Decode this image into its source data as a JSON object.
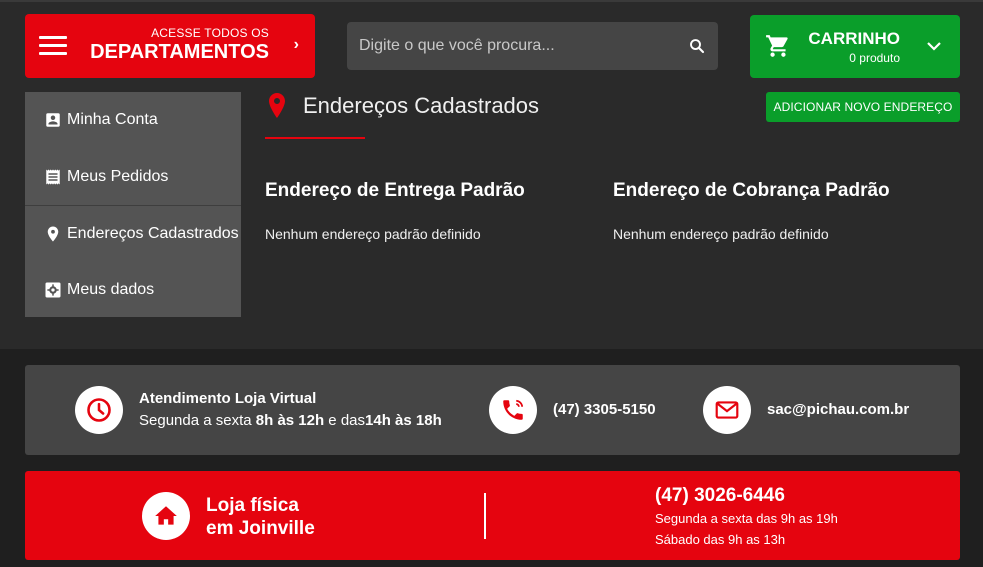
{
  "header": {
    "departments": {
      "top_label": "ACESSE TODOS OS",
      "main_label": "DEPARTAMENTOS"
    },
    "search": {
      "placeholder": "Digite o que você procura..."
    },
    "cart": {
      "title": "CARRINHO",
      "count": "0 produto"
    }
  },
  "sidebar": {
    "items": [
      {
        "label": "Minha Conta",
        "icon": "account-box-icon"
      },
      {
        "label": "Meus Pedidos",
        "icon": "receipt-icon"
      },
      {
        "label": "Endereços Cadastrados",
        "icon": "location-pin-icon"
      },
      {
        "label": "Meus dados",
        "icon": "settings-box-icon"
      }
    ]
  },
  "main": {
    "title": "Endereços Cadastrados",
    "add_button": "ADICIONAR NOVO ENDEREÇO",
    "delivery": {
      "heading": "Endereço de Entrega Padrão",
      "text": "Nenhum endereço padrão definido"
    },
    "billing": {
      "heading": "Endereço de Cobrança Padrão",
      "text": "Nenhum endereço padrão definido"
    }
  },
  "contact": {
    "service_title": "Atendimento Loja Virtual",
    "hours_prefix": "Segunda a sexta ",
    "hours_a": "8h às 12h",
    "hours_mid": " e das",
    "hours_b": "14h às 18h",
    "phone": "(47) 3305-5150",
    "email": "sac@pichau.com.br"
  },
  "store": {
    "name_line1": "Loja física",
    "name_line2": "em Joinville",
    "phone": "(47) 3026-6446",
    "hours_weekday": "Segunda a sexta das 9h as 19h",
    "hours_saturday": "Sábado das 9h as 13h"
  },
  "colors": {
    "brand_red": "#e5040f",
    "green": "#0a9e2a",
    "background": "#2a2a2a"
  }
}
